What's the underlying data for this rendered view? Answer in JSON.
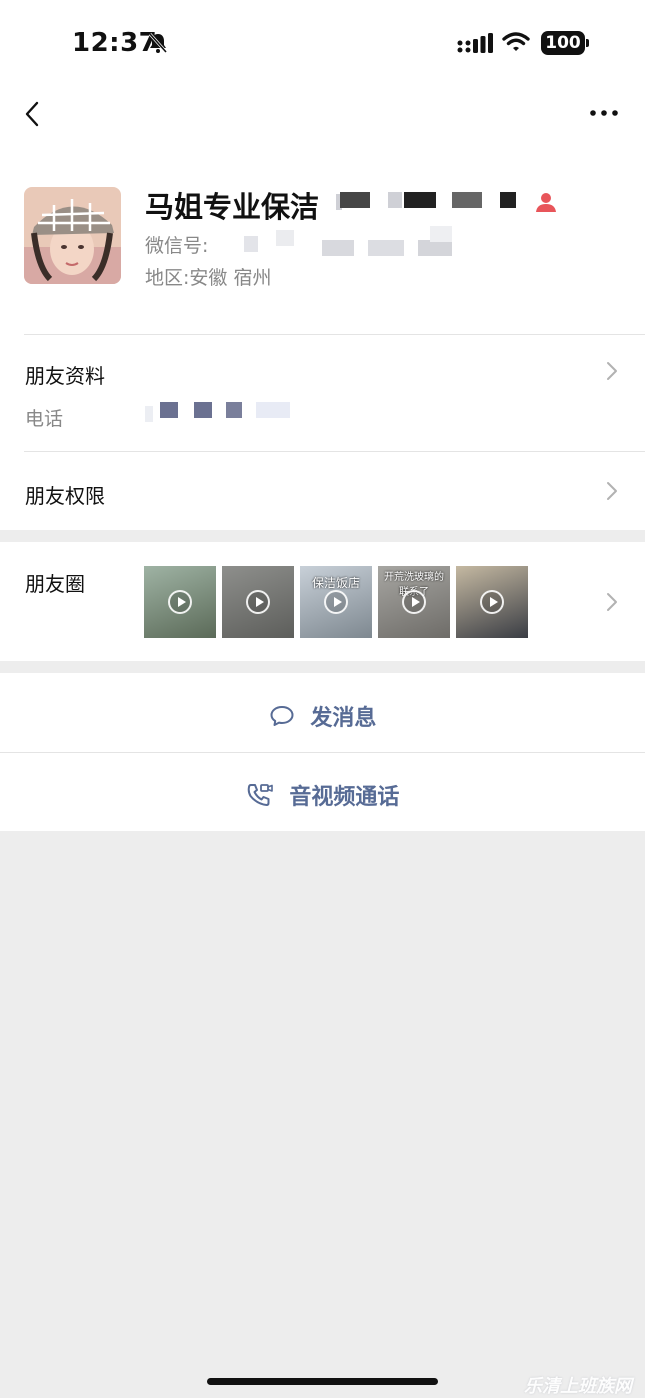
{
  "status_bar": {
    "time": "12:37",
    "battery": "100"
  },
  "profile": {
    "name": "马姐专业保洁",
    "wechat_id_label": "微信号:",
    "region": "地区:安徽 宿州"
  },
  "rows": {
    "friend_info": "朋友资料",
    "phone_label": "电话",
    "permissions": "朋友权限",
    "moments": "朋友圈"
  },
  "moments_thumbs": [
    {
      "caption": "",
      "colors": [
        "#9fb3a4",
        "#5b6a58"
      ]
    },
    {
      "caption": "",
      "colors": [
        "#8e8f8c",
        "#5d5e5b"
      ]
    },
    {
      "caption": "保洁饭店",
      "colors": [
        "#c8d0d8",
        "#7e8890"
      ]
    },
    {
      "caption": "开荒洗玻璃的联系了",
      "colors": [
        "#a7a6a2",
        "#6e6c68"
      ]
    },
    {
      "caption": "",
      "colors": [
        "#c5b9a2",
        "#3a3d44"
      ]
    }
  ],
  "actions": {
    "message": "发消息",
    "call": "音视频通话"
  },
  "colors": {
    "link": "#576b95",
    "background": "#ededed",
    "accent_red": "#e8555a"
  },
  "watermark": "乐清上班族网"
}
